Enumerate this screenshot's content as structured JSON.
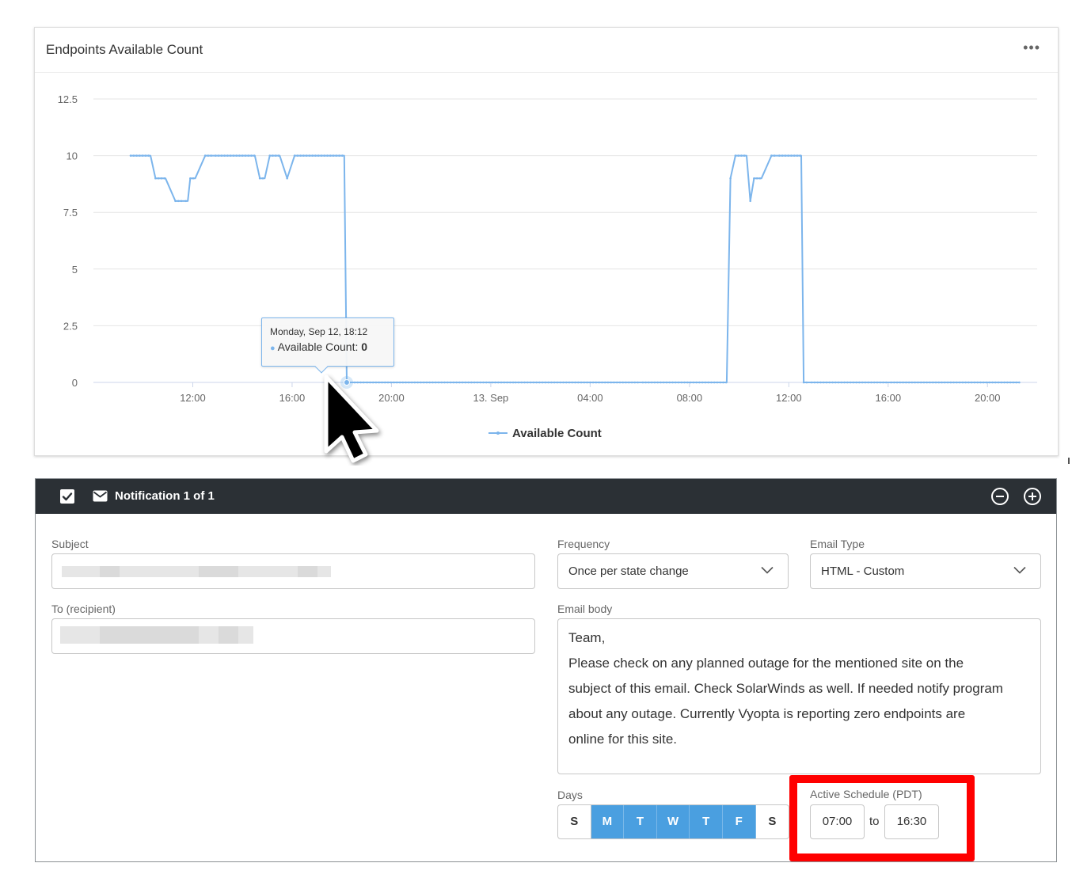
{
  "chart_card": {
    "title": "Endpoints Available Count",
    "menu_icon": "ellipsis-icon",
    "tooltip": {
      "date": "Monday, Sep 12, 18:12",
      "series_label": "Available Count: ",
      "value": "0"
    }
  },
  "chart_data": {
    "type": "line",
    "title": "Endpoints Available Count",
    "ylim": [
      0,
      12.5
    ],
    "y_ticks": [
      "0",
      "2.5",
      "5",
      "7.5",
      "10",
      "12.5"
    ],
    "x_ticks": [
      "12:00",
      "16:00",
      "20:00",
      "13. Sep",
      "04:00",
      "08:00",
      "12:00",
      "16:00",
      "20:00"
    ],
    "x_tick_hours": [
      12,
      16,
      20,
      24,
      28,
      32,
      36,
      40,
      44
    ],
    "grid": true,
    "legend_position": "bottom-center",
    "color": "#7cb5ec",
    "series": [
      {
        "name": "Available Count",
        "x": [
          9.5,
          10.3,
          10.5,
          10.9,
          11.3,
          11.6,
          11.8,
          11.9,
          12.1,
          12.5,
          12.8,
          14.5,
          14.7,
          14.9,
          15.1,
          15.5,
          15.8,
          16.1,
          18.1,
          18.2,
          18.4,
          18.9,
          25.0,
          30.0,
          33.5,
          33.65,
          33.85,
          34.3,
          34.45,
          34.6,
          34.9,
          35.3,
          35.5,
          36.5,
          36.6,
          36.8,
          40.0,
          45.3
        ],
        "y": [
          10,
          10,
          9,
          9,
          8,
          8,
          8,
          9,
          9,
          10,
          10,
          10,
          9,
          9,
          10,
          10,
          9,
          10,
          10,
          0,
          0,
          0,
          0,
          0,
          0,
          9,
          10,
          10,
          8,
          9,
          9,
          10,
          10,
          10,
          0,
          0,
          0,
          0
        ]
      }
    ]
  },
  "notification": {
    "title": "Notification 1 of 1",
    "subject_label": "Subject",
    "recipient_label": "To (recipient)",
    "frequency_label": "Frequency",
    "frequency_value": "Once per state change",
    "email_type_label": "Email Type",
    "email_type_value": "HTML - Custom",
    "email_body_label": "Email body",
    "email_body_lines": [
      "Team,",
      "Please check on any planned outage for the mentioned site on the",
      "subject of this email. Check SolarWinds as well. If needed notify program",
      "about any outage. Currently Vyopta is reporting zero endpoints are",
      "online for this site."
    ],
    "days_label": "Days",
    "days": [
      {
        "label": "S",
        "active": false
      },
      {
        "label": "M",
        "active": true
      },
      {
        "label": "T",
        "active": true
      },
      {
        "label": "W",
        "active": true
      },
      {
        "label": "T",
        "active": true
      },
      {
        "label": "F",
        "active": true
      },
      {
        "label": "S",
        "active": false
      }
    ],
    "schedule_label": "Active Schedule (PDT)",
    "schedule_from": "07:00",
    "schedule_to_label": "to",
    "schedule_to": "16:30"
  },
  "colors": {
    "series": "#7cb5ec",
    "header_bg": "#2b3035",
    "day_active": "#4a9fe0",
    "highlight": "#ff0000"
  }
}
